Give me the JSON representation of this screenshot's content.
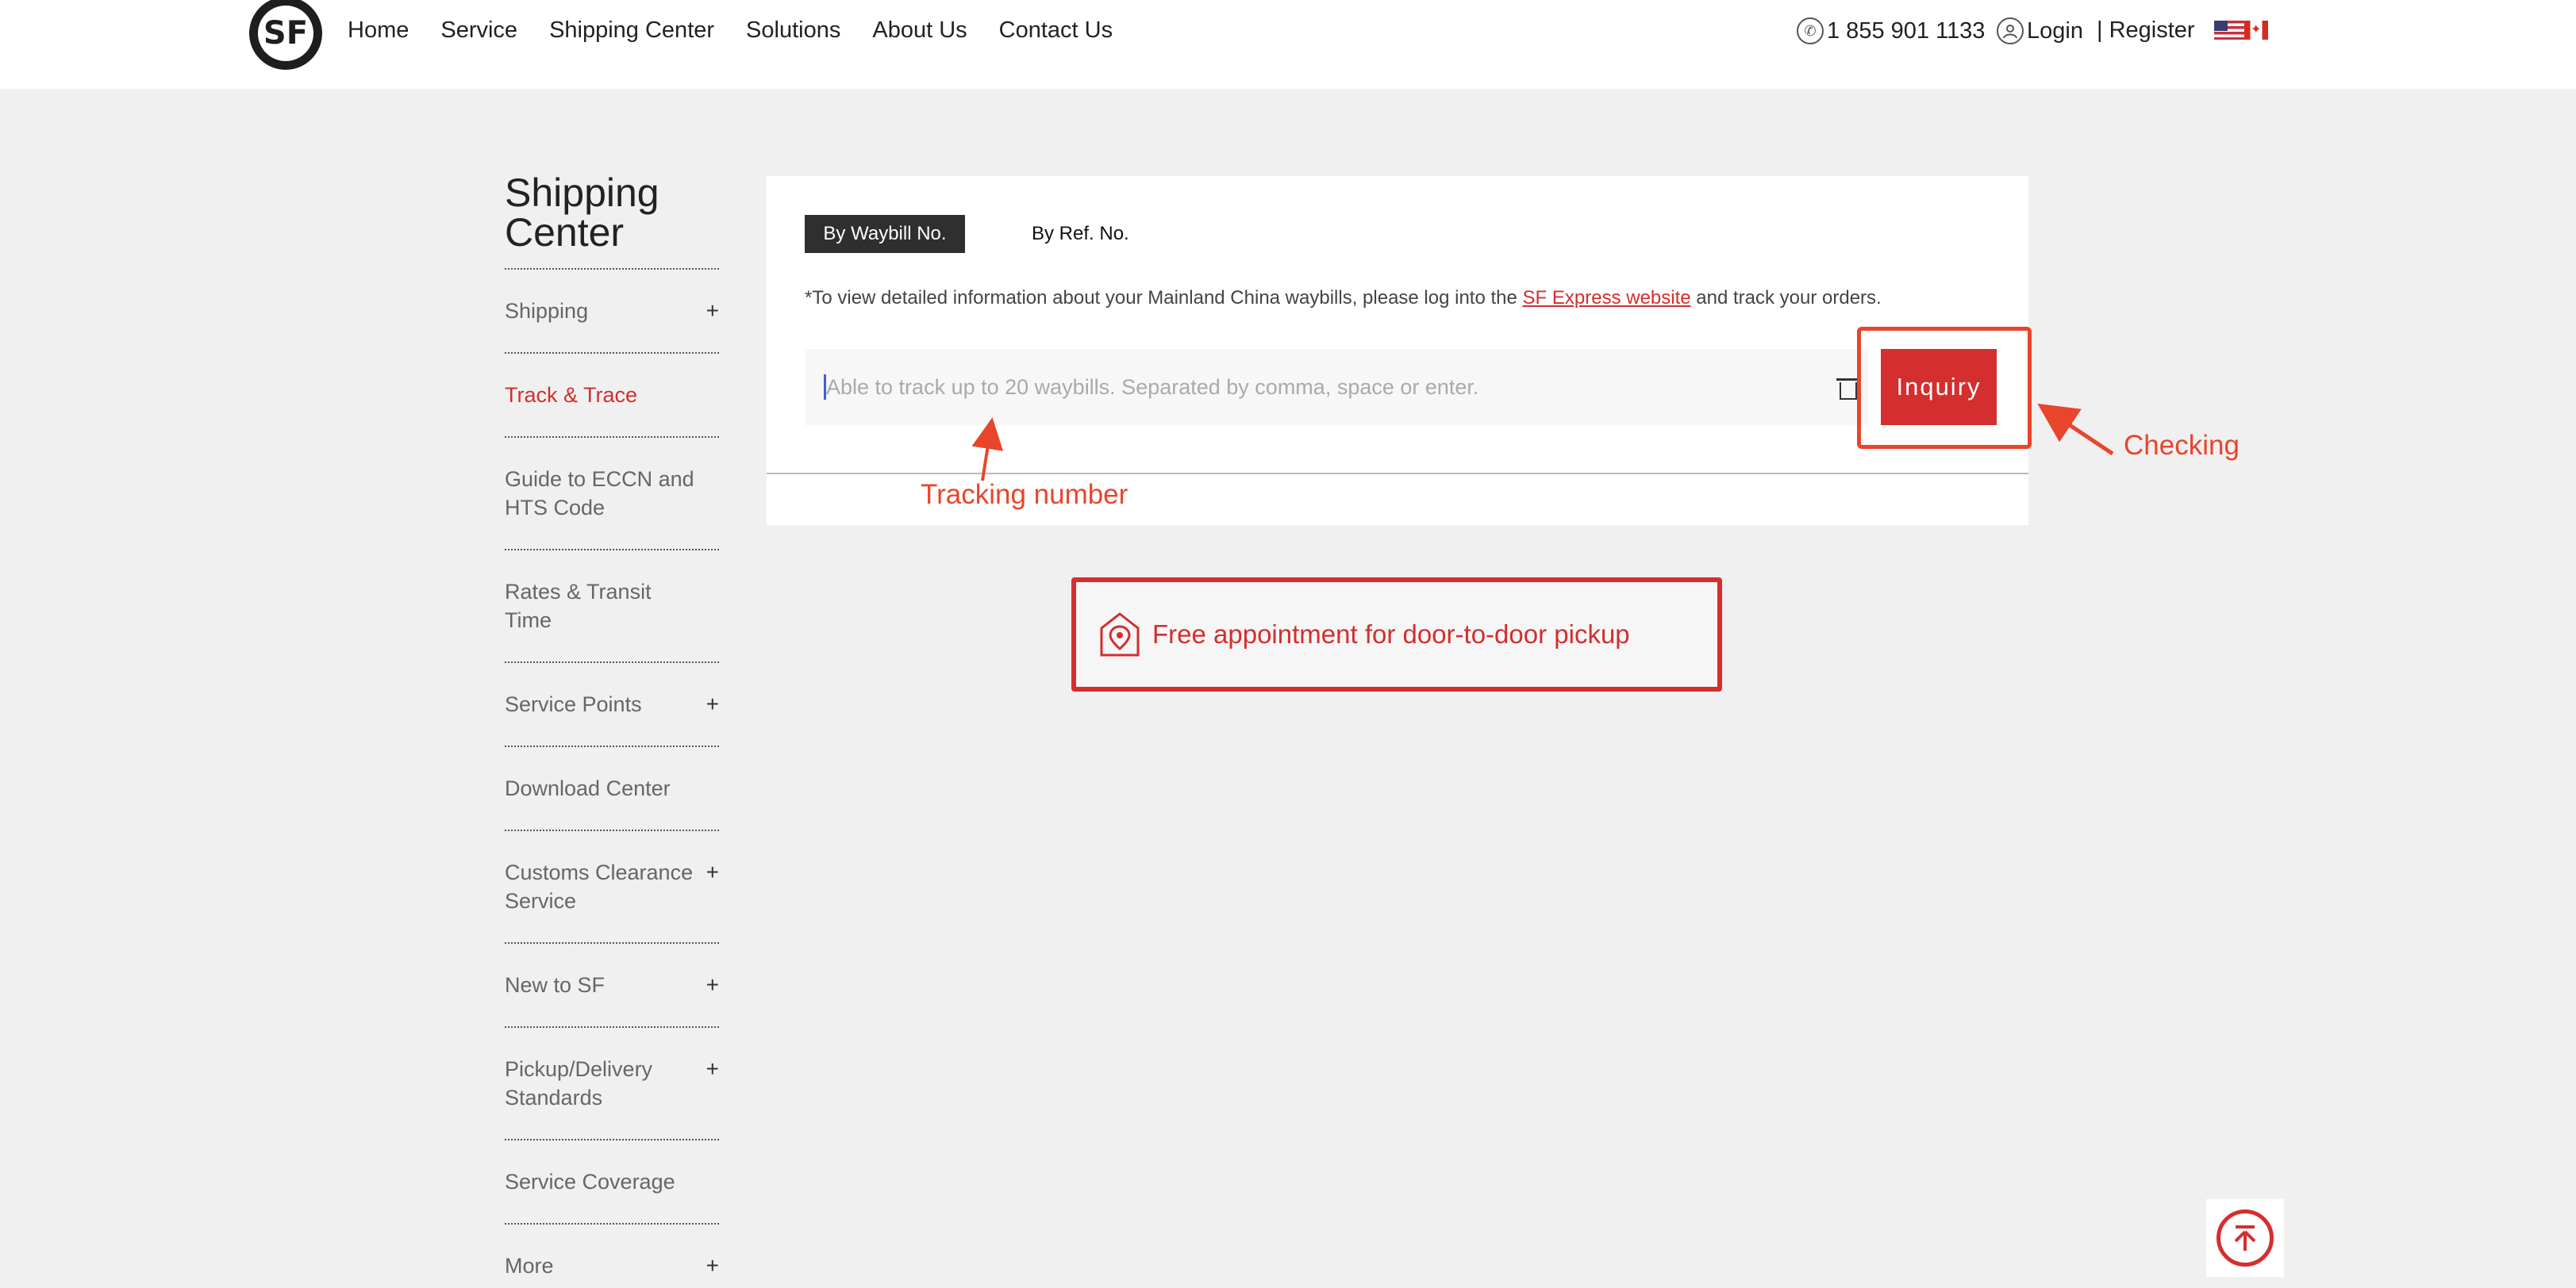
{
  "header": {
    "logo_text": "SF",
    "nav": [
      "Home",
      "Service",
      "Shipping Center",
      "Solutions",
      "About Us",
      "Contact Us"
    ],
    "phone": "1 855 901 1133",
    "login": "Login",
    "register": "| Register"
  },
  "sidebar": {
    "title": "Shipping Center",
    "items": [
      {
        "label": "Shipping",
        "expandable": true
      },
      {
        "label": "Track & Trace",
        "expandable": false,
        "active": true
      },
      {
        "label": "Guide to ECCN and HTS Code",
        "expandable": false
      },
      {
        "label": "Rates & Transit Time",
        "expandable": false
      },
      {
        "label": "Service Points",
        "expandable": true
      },
      {
        "label": "Download Center",
        "expandable": false
      },
      {
        "label": "Customs Clearance Service",
        "expandable": true
      },
      {
        "label": "New to SF",
        "expandable": true
      },
      {
        "label": "Pickup/Delivery Standards",
        "expandable": true
      },
      {
        "label": "Service Coverage",
        "expandable": false
      },
      {
        "label": "More",
        "expandable": true
      }
    ],
    "plus_symbol": "+"
  },
  "tracking": {
    "tab_waybill": "By Waybill No.",
    "tab_ref": "By Ref. No.",
    "notice_prefix": "*To view detailed information about your Mainland China waybills, please log into the ",
    "notice_link": "SF Express website",
    "notice_suffix": " and track your orders.",
    "input_placeholder": "Able to track up to 20 waybills. Separated by comma, space or enter.",
    "inquiry_label": "Inquiry"
  },
  "annotations": {
    "checking": "Checking",
    "tracking_number": "Tracking number",
    "color": "#e8452c"
  },
  "promo": {
    "text": "Free appointment for door-to-door pickup"
  },
  "colors": {
    "brand_red": "#d42e2e",
    "tab_active_bg": "#2f2f2f",
    "page_bg": "#f0f0f0"
  }
}
